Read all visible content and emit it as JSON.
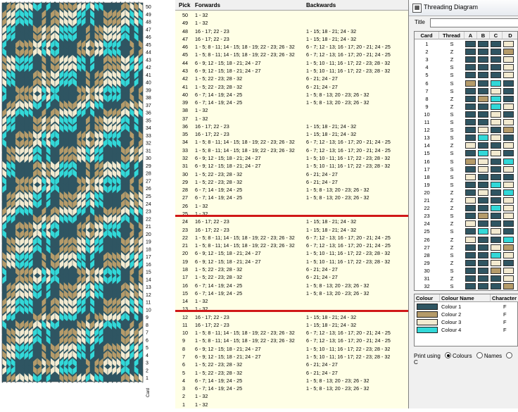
{
  "colors": {
    "dark": "#2f5562",
    "tan": "#b59b6a",
    "cream": "#f3ead0",
    "cyan": "#32d8d8",
    "red": "#d01818"
  },
  "pattern": {
    "row_numbers": [
      "50",
      "49",
      "48",
      "47",
      "46",
      "45",
      "44",
      "43",
      "42",
      "41",
      "40",
      "39",
      "38",
      "37",
      "36",
      "35",
      "34",
      "33",
      "32",
      "31",
      "30",
      "29",
      "28",
      "27",
      "26",
      "25",
      "24",
      "23",
      "22",
      "21",
      "20",
      "19",
      "18",
      "17",
      "16",
      "15",
      "14",
      "13",
      "12",
      "11",
      "10",
      "9",
      "8",
      "7",
      "6",
      "5",
      "4",
      "3",
      "2",
      "1"
    ],
    "bottom_label": "Card"
  },
  "picks": {
    "headers": {
      "pick": "Pick",
      "forwards": "Forwards",
      "backwards": "Backwards"
    },
    "rows": [
      {
        "n": "50",
        "f": "1 - 32",
        "b": ""
      },
      {
        "n": "49",
        "f": "1 - 32",
        "b": ""
      },
      {
        "n": "48",
        "f": "16 - 17; 22 - 23",
        "b": "1 - 15; 18 - 21; 24 - 32"
      },
      {
        "n": "47",
        "f": "16 - 17; 22 - 23",
        "b": "1 - 15; 18 - 21; 24 - 32"
      },
      {
        "n": "46",
        "f": "1 - 5; 8 - 11; 14 - 15; 18 - 19; 22 - 23; 26 - 32",
        "b": "6 - 7; 12 - 13; 16 - 17; 20 - 21; 24 - 25"
      },
      {
        "n": "45",
        "f": "1 - 5; 8 - 11; 14 - 15; 18 - 19; 22 - 23; 26 - 32",
        "b": "6 - 7; 12 - 13; 16 - 17; 20 - 21; 24 - 25"
      },
      {
        "n": "44",
        "f": "6 - 9; 12 - 15; 18 - 21; 24 - 27",
        "b": "1 - 5; 10 - 11; 16 - 17; 22 - 23; 28 - 32"
      },
      {
        "n": "43",
        "f": "6 - 9; 12 - 15; 18 - 21; 24 - 27",
        "b": "1 - 5; 10 - 11; 16 - 17; 22 - 23; 28 - 32"
      },
      {
        "n": "42",
        "f": "1 - 5; 22 - 23; 28 - 32",
        "b": "6 - 21; 24 - 27"
      },
      {
        "n": "41",
        "f": "1 - 5; 22 - 23; 28 - 32",
        "b": "6 - 21; 24 - 27"
      },
      {
        "n": "40",
        "f": "6 - 7; 14 - 19; 24 - 25",
        "b": "1 - 5; 8 - 13; 20 - 23; 26 - 32"
      },
      {
        "n": "39",
        "f": "6 - 7; 14 - 19; 24 - 25",
        "b": "1 - 5; 8 - 13; 20 - 23; 26 - 32"
      },
      {
        "n": "38",
        "f": "1 - 32",
        "b": ""
      },
      {
        "n": "37",
        "f": "1 - 32",
        "b": ""
      },
      {
        "n": "36",
        "f": "16 - 17; 22 - 23",
        "b": "1 - 15; 18 - 21; 24 - 32"
      },
      {
        "n": "35",
        "f": "16 - 17; 22 - 23",
        "b": "1 - 15; 18 - 21; 24 - 32"
      },
      {
        "n": "34",
        "f": "1 - 5; 8 - 11; 14 - 15; 18 - 19; 22 - 23; 26 - 32",
        "b": "6 - 7; 12 - 13; 16 - 17; 20 - 21; 24 - 25"
      },
      {
        "n": "33",
        "f": "1 - 5; 8 - 11; 14 - 15; 18 - 19; 22 - 23; 26 - 32",
        "b": "6 - 7; 12 - 13; 16 - 17; 20 - 21; 24 - 25"
      },
      {
        "n": "32",
        "f": "6 - 9; 12 - 15; 18 - 21; 24 - 27",
        "b": "1 - 5; 10 - 11; 16 - 17; 22 - 23; 28 - 32"
      },
      {
        "n": "31",
        "f": "6 - 9; 12 - 15; 18 - 21; 24 - 27",
        "b": "1 - 5; 10 - 11; 16 - 17; 22 - 23; 28 - 32"
      },
      {
        "n": "30",
        "f": "1 - 5; 22 - 23; 28 - 32",
        "b": "6 - 21; 24 - 27"
      },
      {
        "n": "29",
        "f": "1 - 5; 22 - 23; 28 - 32",
        "b": "6 - 21; 24 - 27"
      },
      {
        "n": "28",
        "f": "6 - 7; 14 - 19; 24 - 25",
        "b": "1 - 5; 8 - 13; 20 - 23; 26 - 32"
      },
      {
        "n": "27",
        "f": "6 - 7; 14 - 19; 24 - 25",
        "b": "1 - 5; 8 - 13; 20 - 23; 26 - 32"
      },
      {
        "n": "26",
        "f": "1 - 32",
        "b": ""
      },
      {
        "n": "25",
        "f": "1 - 32",
        "b": ""
      },
      {
        "n": "24",
        "f": "16 - 17; 22 - 23",
        "b": "1 - 15; 18 - 21; 24 - 32"
      },
      {
        "n": "23",
        "f": "16 - 17; 22 - 23",
        "b": "1 - 15; 18 - 21; 24 - 32"
      },
      {
        "n": "22",
        "f": "1 - 5; 8 - 11; 14 - 15; 18 - 19; 22 - 23; 26 - 32",
        "b": "6 - 7; 12 - 13; 16 - 17; 20 - 21; 24 - 25"
      },
      {
        "n": "21",
        "f": "1 - 5; 8 - 11; 14 - 15; 18 - 19; 22 - 23; 26 - 32",
        "b": "6 - 7; 12 - 13; 16 - 17; 20 - 21; 24 - 25"
      },
      {
        "n": "20",
        "f": "6 - 9; 12 - 15; 18 - 21; 24 - 27",
        "b": "1 - 5; 10 - 11; 16 - 17; 22 - 23; 28 - 32"
      },
      {
        "n": "19",
        "f": "6 - 9; 12 - 15; 18 - 21; 24 - 27",
        "b": "1 - 5; 10 - 11; 16 - 17; 22 - 23; 28 - 32"
      },
      {
        "n": "18",
        "f": "1 - 5; 22 - 23; 28 - 32",
        "b": "6 - 21; 24 - 27"
      },
      {
        "n": "17",
        "f": "1 - 5; 22 - 23; 28 - 32",
        "b": "6 - 21; 24 - 27"
      },
      {
        "n": "16",
        "f": "6 - 7; 14 - 19; 24 - 25",
        "b": "1 - 5; 8 - 13; 20 - 23; 26 - 32"
      },
      {
        "n": "15",
        "f": "6 - 7; 14 - 19; 24 - 25",
        "b": "1 - 5; 8 - 13; 20 - 23; 26 - 32"
      },
      {
        "n": "14",
        "f": "1 - 32",
        "b": ""
      },
      {
        "n": "13",
        "f": "1 - 32",
        "b": ""
      },
      {
        "n": "12",
        "f": "16 - 17; 22 - 23",
        "b": "1 - 15; 18 - 21; 24 - 32"
      },
      {
        "n": "11",
        "f": "16 - 17; 22 - 23",
        "b": "1 - 15; 18 - 21; 24 - 32"
      },
      {
        "n": "10",
        "f": "1 - 5; 8 - 11; 14 - 15; 18 - 19; 22 - 23; 26 - 32",
        "b": "6 - 7; 12 - 13; 16 - 17; 20 - 21; 24 - 25"
      },
      {
        "n": "9",
        "f": "1 - 5; 8 - 11; 14 - 15; 18 - 19; 22 - 23; 26 - 32",
        "b": "6 - 7; 12 - 13; 16 - 17; 20 - 21; 24 - 25"
      },
      {
        "n": "8",
        "f": "6 - 9; 12 - 15; 18 - 21; 24 - 27",
        "b": "1 - 5; 10 - 11; 16 - 17; 22 - 23; 28 - 32"
      },
      {
        "n": "7",
        "f": "6 - 9; 12 - 15; 18 - 21; 24 - 27",
        "b": "1 - 5; 10 - 11; 16 - 17; 22 - 23; 28 - 32"
      },
      {
        "n": "6",
        "f": "1 - 5; 22 - 23; 28 - 32",
        "b": "6 - 21; 24 - 27"
      },
      {
        "n": "5",
        "f": "1 - 5; 22 - 23; 28 - 32",
        "b": "6 - 21; 24 - 27"
      },
      {
        "n": "4",
        "f": "6 - 7; 14 - 19; 24 - 25",
        "b": "1 - 5; 8 - 13; 20 - 23; 26 - 32"
      },
      {
        "n": "3",
        "f": "6 - 7; 14 - 19; 24 - 25",
        "b": "1 - 5; 8 - 13; 20 - 23; 26 - 32"
      },
      {
        "n": "2",
        "f": "1 - 32",
        "b": ""
      },
      {
        "n": "1",
        "f": "1 - 32",
        "b": ""
      }
    ]
  },
  "threading": {
    "window_title": "Threading Diagram",
    "title_label": "Title",
    "title_value": "",
    "headers": {
      "card": "Card",
      "thread": "Thread",
      "a": "A",
      "b": "B",
      "c": "C",
      "d": "D"
    },
    "cards": [
      {
        "n": "1",
        "t": "S",
        "h": [
          1,
          1,
          1,
          3
        ]
      },
      {
        "n": "2",
        "t": "Z",
        "h": [
          1,
          1,
          1,
          2
        ]
      },
      {
        "n": "3",
        "t": "Z",
        "h": [
          1,
          1,
          1,
          3
        ]
      },
      {
        "n": "4",
        "t": "S",
        "h": [
          1,
          1,
          1,
          3
        ]
      },
      {
        "n": "5",
        "t": "S",
        "h": [
          1,
          1,
          1,
          3
        ]
      },
      {
        "n": "6",
        "t": "S",
        "h": [
          2,
          1,
          4,
          1
        ]
      },
      {
        "n": "7",
        "t": "S",
        "h": [
          1,
          1,
          3,
          1
        ]
      },
      {
        "n": "8",
        "t": "Z",
        "h": [
          1,
          2,
          4,
          1
        ]
      },
      {
        "n": "9",
        "t": "Z",
        "h": [
          1,
          1,
          4,
          3
        ]
      },
      {
        "n": "10",
        "t": "S",
        "h": [
          1,
          1,
          3,
          1
        ]
      },
      {
        "n": "11",
        "t": "S",
        "h": [
          1,
          1,
          3,
          3
        ]
      },
      {
        "n": "12",
        "t": "S",
        "h": [
          1,
          3,
          1,
          2
        ]
      },
      {
        "n": "13",
        "t": "S",
        "h": [
          1,
          4,
          3,
          1
        ]
      },
      {
        "n": "14",
        "t": "Z",
        "h": [
          3,
          1,
          1,
          3
        ]
      },
      {
        "n": "15",
        "t": "S",
        "h": [
          1,
          4,
          3,
          1
        ]
      },
      {
        "n": "16",
        "t": "S",
        "h": [
          2,
          3,
          1,
          4
        ]
      },
      {
        "n": "17",
        "t": "S",
        "h": [
          1,
          3,
          1,
          3
        ]
      },
      {
        "n": "18",
        "t": "S",
        "h": [
          3,
          1,
          1,
          1
        ]
      },
      {
        "n": "19",
        "t": "S",
        "h": [
          1,
          1,
          4,
          3
        ]
      },
      {
        "n": "20",
        "t": "Z",
        "h": [
          1,
          3,
          1,
          4
        ]
      },
      {
        "n": "21",
        "t": "Z",
        "h": [
          3,
          1,
          1,
          3
        ]
      },
      {
        "n": "22",
        "t": "Z",
        "h": [
          1,
          1,
          4,
          3
        ]
      },
      {
        "n": "23",
        "t": "S",
        "h": [
          1,
          2,
          1,
          3
        ]
      },
      {
        "n": "24",
        "t": "Z",
        "h": [
          3,
          1,
          1,
          1
        ]
      },
      {
        "n": "25",
        "t": "S",
        "h": [
          1,
          4,
          3,
          1
        ]
      },
      {
        "n": "26",
        "t": "Z",
        "h": [
          3,
          1,
          1,
          4
        ]
      },
      {
        "n": "27",
        "t": "Z",
        "h": [
          1,
          1,
          3,
          2
        ]
      },
      {
        "n": "28",
        "t": "S",
        "h": [
          1,
          1,
          4,
          3
        ]
      },
      {
        "n": "29",
        "t": "Z",
        "h": [
          1,
          1,
          3,
          1
        ]
      },
      {
        "n": "30",
        "t": "S",
        "h": [
          1,
          1,
          2,
          3
        ]
      },
      {
        "n": "31",
        "t": "Z",
        "h": [
          1,
          1,
          1,
          3
        ]
      },
      {
        "n": "32",
        "t": "S",
        "h": [
          1,
          1,
          1,
          2
        ]
      }
    ],
    "colour_headers": {
      "colour": "Colour",
      "name": "Colour Name",
      "character": "Character"
    },
    "colour_list": [
      {
        "name": "Colour 1",
        "char": "F",
        "hex": "#2f5562"
      },
      {
        "name": "Colour 2",
        "char": "F",
        "hex": "#b59b6a"
      },
      {
        "name": "Colour 3",
        "char": "F",
        "hex": "#f3ead0"
      },
      {
        "name": "Colour 4",
        "char": "F",
        "hex": "#32d8d8"
      }
    ],
    "print_using": {
      "label": "Print using",
      "options": [
        "Colours",
        "Names",
        "C"
      ],
      "selected": "Colours"
    }
  }
}
